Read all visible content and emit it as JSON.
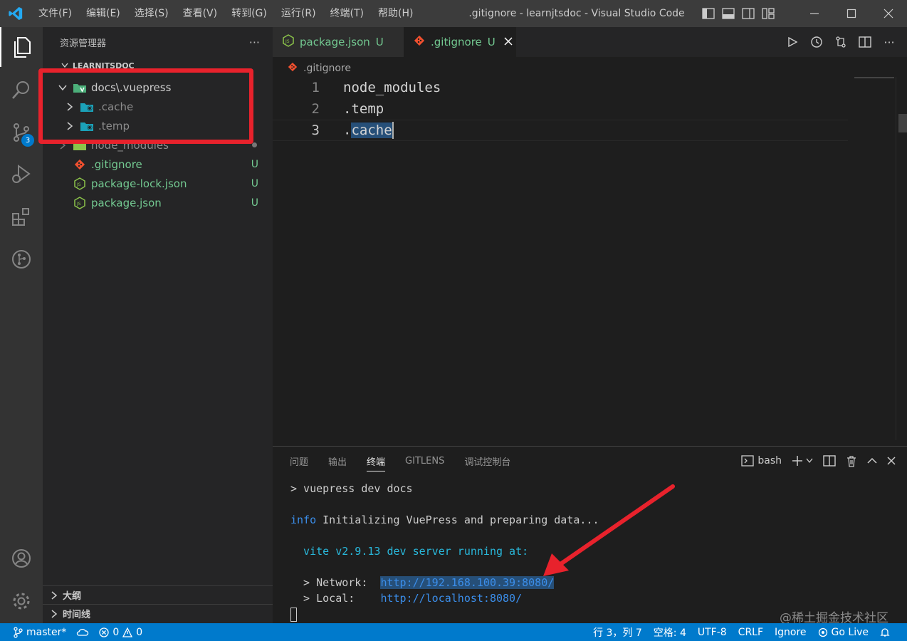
{
  "titlebar": {
    "menu": [
      "文件(F)",
      "编辑(E)",
      "选择(S)",
      "查看(V)",
      "转到(G)",
      "运行(R)",
      "终端(T)",
      "帮助(H)"
    ],
    "title": ".gitignore - learnjtsdoc - Visual Studio Code"
  },
  "activity": {
    "source_control_badge": "3"
  },
  "sidebar": {
    "header": "资源管理器",
    "more": "···",
    "root": "LEARNJTSDOC",
    "tree": [
      {
        "label": "docs\\.vuepress",
        "status": ""
      },
      {
        "label": ".cache",
        "status": ""
      },
      {
        "label": ".temp",
        "status": ""
      },
      {
        "label": "node_modules",
        "status": ""
      },
      {
        "label": ".gitignore",
        "status": "U"
      },
      {
        "label": "package-lock.json",
        "status": "U"
      },
      {
        "label": "package.json",
        "status": "U"
      }
    ],
    "outline": "大纲",
    "timeline": "时间线"
  },
  "editor": {
    "tabs": [
      {
        "label": "package.json",
        "status": "U"
      },
      {
        "label": ".gitignore",
        "status": "U"
      }
    ],
    "breadcrumb": ".gitignore",
    "lines": [
      {
        "no": "1",
        "text": "node_modules"
      },
      {
        "no": "2",
        "text": ".temp"
      },
      {
        "no": "3",
        "prefix": ".",
        "selected": "cache"
      }
    ]
  },
  "panel": {
    "tabs": [
      "问题",
      "输出",
      "终端",
      "GITLENS",
      "调试控制台"
    ],
    "shell": "bash",
    "terminal": {
      "cmd": "> vuepress dev docs",
      "info_word": "info",
      "info_rest": " Initializing VuePress and preparing data...",
      "vite": "  vite v2.9.13 dev server running at:",
      "network_label": "  > Network:  ",
      "network_url": "http://192.168.100.39:8080/",
      "local_label": "  > Local:    ",
      "local_url": "http://localhost:8080/"
    },
    "watermark": "@稀土掘金技术社区"
  },
  "statusbar": {
    "branch": "master*",
    "errors": "0",
    "warnings": "0",
    "position": "行 3，列 7",
    "spaces": "空格: 4",
    "encoding": "UTF-8",
    "eol": "CRLF",
    "language": "Ignore",
    "golive": "Go Live"
  },
  "colors": {
    "accent": "#007acc",
    "untracked": "#73c991",
    "annotation": "#e8222c"
  }
}
